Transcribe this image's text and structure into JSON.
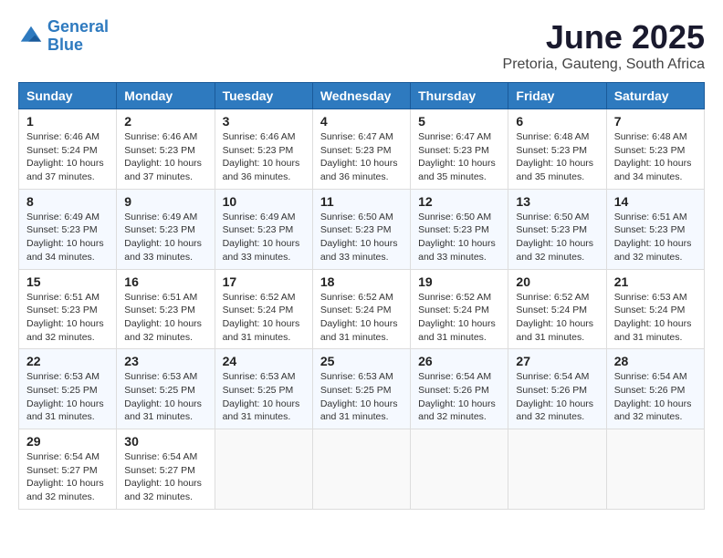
{
  "logo": {
    "line1": "General",
    "line2": "Blue"
  },
  "title": "June 2025",
  "location": "Pretoria, Gauteng, South Africa",
  "headers": [
    "Sunday",
    "Monday",
    "Tuesday",
    "Wednesday",
    "Thursday",
    "Friday",
    "Saturday"
  ],
  "weeks": [
    [
      {
        "day": "1",
        "sunrise": "Sunrise: 6:46 AM",
        "sunset": "Sunset: 5:24 PM",
        "daylight": "Daylight: 10 hours and 37 minutes."
      },
      {
        "day": "2",
        "sunrise": "Sunrise: 6:46 AM",
        "sunset": "Sunset: 5:23 PM",
        "daylight": "Daylight: 10 hours and 37 minutes."
      },
      {
        "day": "3",
        "sunrise": "Sunrise: 6:46 AM",
        "sunset": "Sunset: 5:23 PM",
        "daylight": "Daylight: 10 hours and 36 minutes."
      },
      {
        "day": "4",
        "sunrise": "Sunrise: 6:47 AM",
        "sunset": "Sunset: 5:23 PM",
        "daylight": "Daylight: 10 hours and 36 minutes."
      },
      {
        "day": "5",
        "sunrise": "Sunrise: 6:47 AM",
        "sunset": "Sunset: 5:23 PM",
        "daylight": "Daylight: 10 hours and 35 minutes."
      },
      {
        "day": "6",
        "sunrise": "Sunrise: 6:48 AM",
        "sunset": "Sunset: 5:23 PM",
        "daylight": "Daylight: 10 hours and 35 minutes."
      },
      {
        "day": "7",
        "sunrise": "Sunrise: 6:48 AM",
        "sunset": "Sunset: 5:23 PM",
        "daylight": "Daylight: 10 hours and 34 minutes."
      }
    ],
    [
      {
        "day": "8",
        "sunrise": "Sunrise: 6:49 AM",
        "sunset": "Sunset: 5:23 PM",
        "daylight": "Daylight: 10 hours and 34 minutes."
      },
      {
        "day": "9",
        "sunrise": "Sunrise: 6:49 AM",
        "sunset": "Sunset: 5:23 PM",
        "daylight": "Daylight: 10 hours and 33 minutes."
      },
      {
        "day": "10",
        "sunrise": "Sunrise: 6:49 AM",
        "sunset": "Sunset: 5:23 PM",
        "daylight": "Daylight: 10 hours and 33 minutes."
      },
      {
        "day": "11",
        "sunrise": "Sunrise: 6:50 AM",
        "sunset": "Sunset: 5:23 PM",
        "daylight": "Daylight: 10 hours and 33 minutes."
      },
      {
        "day": "12",
        "sunrise": "Sunrise: 6:50 AM",
        "sunset": "Sunset: 5:23 PM",
        "daylight": "Daylight: 10 hours and 33 minutes."
      },
      {
        "day": "13",
        "sunrise": "Sunrise: 6:50 AM",
        "sunset": "Sunset: 5:23 PM",
        "daylight": "Daylight: 10 hours and 32 minutes."
      },
      {
        "day": "14",
        "sunrise": "Sunrise: 6:51 AM",
        "sunset": "Sunset: 5:23 PM",
        "daylight": "Daylight: 10 hours and 32 minutes."
      }
    ],
    [
      {
        "day": "15",
        "sunrise": "Sunrise: 6:51 AM",
        "sunset": "Sunset: 5:23 PM",
        "daylight": "Daylight: 10 hours and 32 minutes."
      },
      {
        "day": "16",
        "sunrise": "Sunrise: 6:51 AM",
        "sunset": "Sunset: 5:23 PM",
        "daylight": "Daylight: 10 hours and 32 minutes."
      },
      {
        "day": "17",
        "sunrise": "Sunrise: 6:52 AM",
        "sunset": "Sunset: 5:24 PM",
        "daylight": "Daylight: 10 hours and 31 minutes."
      },
      {
        "day": "18",
        "sunrise": "Sunrise: 6:52 AM",
        "sunset": "Sunset: 5:24 PM",
        "daylight": "Daylight: 10 hours and 31 minutes."
      },
      {
        "day": "19",
        "sunrise": "Sunrise: 6:52 AM",
        "sunset": "Sunset: 5:24 PM",
        "daylight": "Daylight: 10 hours and 31 minutes."
      },
      {
        "day": "20",
        "sunrise": "Sunrise: 6:52 AM",
        "sunset": "Sunset: 5:24 PM",
        "daylight": "Daylight: 10 hours and 31 minutes."
      },
      {
        "day": "21",
        "sunrise": "Sunrise: 6:53 AM",
        "sunset": "Sunset: 5:24 PM",
        "daylight": "Daylight: 10 hours and 31 minutes."
      }
    ],
    [
      {
        "day": "22",
        "sunrise": "Sunrise: 6:53 AM",
        "sunset": "Sunset: 5:25 PM",
        "daylight": "Daylight: 10 hours and 31 minutes."
      },
      {
        "day": "23",
        "sunrise": "Sunrise: 6:53 AM",
        "sunset": "Sunset: 5:25 PM",
        "daylight": "Daylight: 10 hours and 31 minutes."
      },
      {
        "day": "24",
        "sunrise": "Sunrise: 6:53 AM",
        "sunset": "Sunset: 5:25 PM",
        "daylight": "Daylight: 10 hours and 31 minutes."
      },
      {
        "day": "25",
        "sunrise": "Sunrise: 6:53 AM",
        "sunset": "Sunset: 5:25 PM",
        "daylight": "Daylight: 10 hours and 31 minutes."
      },
      {
        "day": "26",
        "sunrise": "Sunrise: 6:54 AM",
        "sunset": "Sunset: 5:26 PM",
        "daylight": "Daylight: 10 hours and 32 minutes."
      },
      {
        "day": "27",
        "sunrise": "Sunrise: 6:54 AM",
        "sunset": "Sunset: 5:26 PM",
        "daylight": "Daylight: 10 hours and 32 minutes."
      },
      {
        "day": "28",
        "sunrise": "Sunrise: 6:54 AM",
        "sunset": "Sunset: 5:26 PM",
        "daylight": "Daylight: 10 hours and 32 minutes."
      }
    ],
    [
      {
        "day": "29",
        "sunrise": "Sunrise: 6:54 AM",
        "sunset": "Sunset: 5:27 PM",
        "daylight": "Daylight: 10 hours and 32 minutes."
      },
      {
        "day": "30",
        "sunrise": "Sunrise: 6:54 AM",
        "sunset": "Sunset: 5:27 PM",
        "daylight": "Daylight: 10 hours and 32 minutes."
      },
      null,
      null,
      null,
      null,
      null
    ]
  ]
}
